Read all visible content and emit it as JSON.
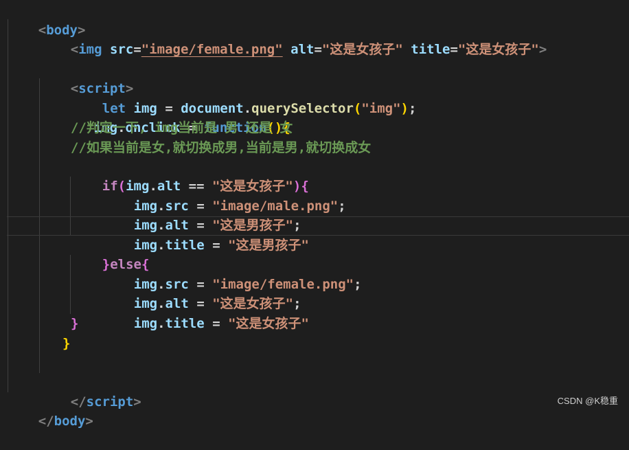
{
  "code": {
    "body_open": [
      "<",
      "body",
      ">"
    ],
    "img_tag": [
      "<",
      "img",
      " ",
      "src",
      "=",
      "\"image/female.png\"",
      " ",
      "alt",
      "=",
      "\"这是女孩子\"",
      " ",
      "title",
      "=",
      "\"这是女孩子\"",
      ">"
    ],
    "script_open": [
      "<",
      "script",
      ">"
    ],
    "let_line": [
      "let",
      " ",
      "img",
      " = ",
      "document",
      ".",
      "querySelector",
      "(",
      "\"img\"",
      ")",
      ";"
    ],
    "onclick_line": [
      "img",
      ".",
      "onclick",
      " = ",
      "function",
      "()",
      "{"
    ],
    "comment1": "//判定一下, img当前是 男 还是 女",
    "comment2": "//如果当前是女,就切换成男,当前是男,就切换成女",
    "if_line": [
      "if",
      "(",
      "img",
      ".",
      "alt",
      " == ",
      "\"这是女孩子\"",
      ")",
      "{"
    ],
    "male_src": [
      "img",
      ".",
      "src",
      " = ",
      "\"image/male.png\"",
      ";"
    ],
    "male_alt": [
      "img",
      ".",
      "alt",
      " = ",
      "\"这是男孩子\"",
      ";"
    ],
    "male_title": [
      "img",
      ".",
      "title",
      " = ",
      "\"这是男孩子\""
    ],
    "else_line": [
      "}",
      "else",
      "{"
    ],
    "female_src": [
      "img",
      ".",
      "src",
      " = ",
      "\"image/female.png\"",
      ";"
    ],
    "female_alt": [
      "img",
      ".",
      "alt",
      " = ",
      "\"这是女孩子\"",
      ";"
    ],
    "female_title": [
      "img",
      ".",
      "title",
      " = ",
      "\"这是女孩子\""
    ],
    "if_close": "}",
    "fn_close": "}",
    "script_close": [
      "</",
      "script",
      ">"
    ],
    "body_close": [
      "</",
      "body",
      ">"
    ]
  },
  "watermark": "CSDN @K稳重"
}
